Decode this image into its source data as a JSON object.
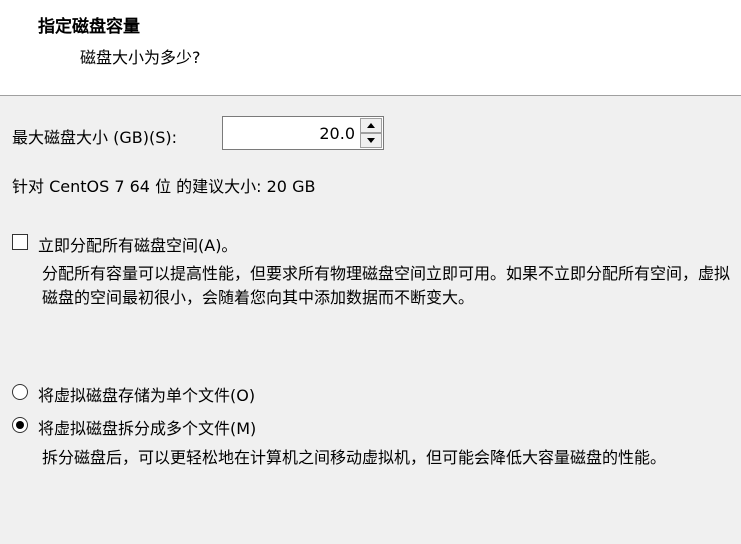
{
  "header": {
    "title": "指定磁盘容量",
    "subtitle": "磁盘大小为多少?"
  },
  "disk_size": {
    "label": "最大磁盘大小 (GB)(S):",
    "value": "20.0"
  },
  "recommendation": "针对 CentOS 7 64 位 的建议大小: 20 GB",
  "allocate": {
    "label": "立即分配所有磁盘空间(A)。",
    "checked": false,
    "description": "分配所有容量可以提高性能，但要求所有物理磁盘空间立即可用。如果不立即分配所有空间，虚拟磁盘的空间最初很小，会随着您向其中添加数据而不断变大。"
  },
  "storage_options": [
    {
      "label": "将虚拟磁盘存储为单个文件(O)",
      "selected": false
    },
    {
      "label": "将虚拟磁盘拆分成多个文件(M)",
      "selected": true
    }
  ],
  "split_description": "拆分磁盘后，可以更轻松地在计算机之间移动虚拟机，但可能会降低大容量磁盘的性能。"
}
